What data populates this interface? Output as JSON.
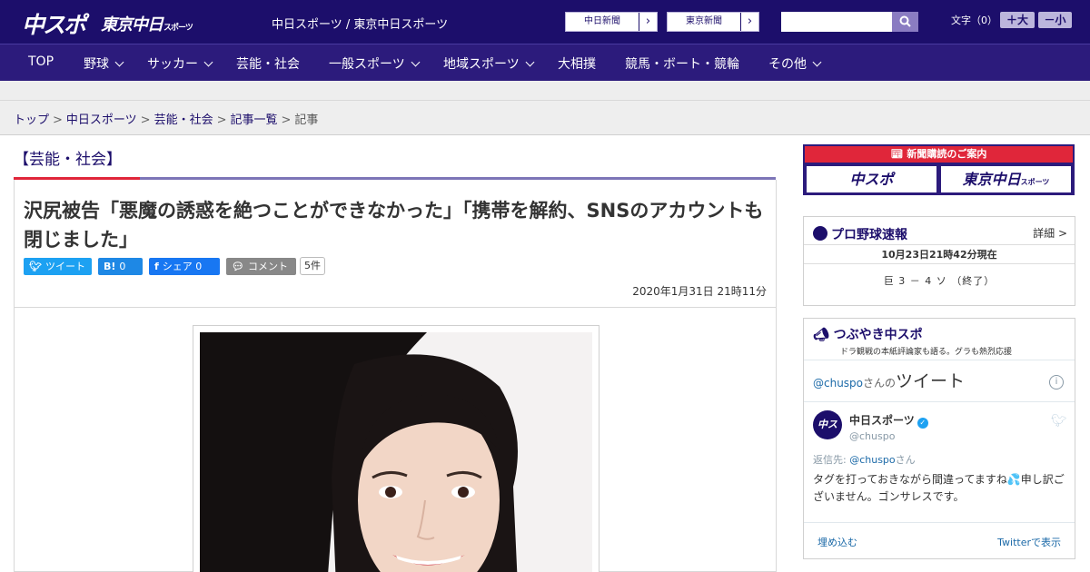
{
  "header": {
    "logo_chuspo": "中スポ",
    "logo_tokyo": "東京中日",
    "logo_tokyo_suffix": "スポーツ",
    "site_name": "中日スポーツ / 東京中日スポーツ",
    "ext_links": [
      {
        "label": "中日新聞"
      },
      {
        "label": "東京新聞"
      }
    ],
    "search_placeholder": "",
    "font_label": "文字（0）",
    "font_up": "＋大",
    "font_down": "－小"
  },
  "nav": {
    "items": [
      {
        "label": "TOP",
        "dropdown": false
      },
      {
        "label": "野球",
        "dropdown": true
      },
      {
        "label": "サッカー",
        "dropdown": true
      },
      {
        "label": "芸能・社会",
        "dropdown": false
      },
      {
        "label": "一般スポーツ",
        "dropdown": true
      },
      {
        "label": "地域スポーツ",
        "dropdown": true
      },
      {
        "label": "大相撲",
        "dropdown": false
      },
      {
        "label": "競馬・ボート・競輪",
        "dropdown": false
      },
      {
        "label": "その他",
        "dropdown": true
      }
    ]
  },
  "breadcrumb": {
    "items": [
      "トップ",
      "中日スポーツ",
      "芸能・社会",
      "記事一覧"
    ],
    "current": "記事",
    "separator": ">"
  },
  "article": {
    "category": "【芸能・社会】",
    "headline": "沢尻被告「悪魔の誘惑を絶つことができなかった」「携帯を解約、SNSのアカウントも閉じました」",
    "share": {
      "tweet": "ツイート",
      "hatena_icon": "B!",
      "hatena_count": "0",
      "facebook": "シェア 0",
      "comment": "コメント",
      "comment_count": "5件"
    },
    "date": "2020年1月31日 21時11分"
  },
  "sidebar": {
    "ad": {
      "title": "新聞購読のご案内",
      "logo1": "中スポ",
      "logo2": "東京中日",
      "logo2_suffix": "スポーツ"
    },
    "baseball": {
      "title": "プロ野球速報",
      "detail": "詳細 >",
      "updated": "10月23日21時42分現在",
      "score": "巨 3 － 4 ソ （終了）"
    },
    "twitter": {
      "title": "つぶやき中スポ",
      "subtitle": "ドラ観戦の本紙評論家も語る。グラも熱烈応援",
      "handle_prefix": "@chuspo",
      "handle_suffix": "さんの",
      "tweets_label": "ツイート",
      "user_name": "中日スポーツ",
      "user_handle": "@chuspo",
      "avatar_text": "中スポ",
      "reply_prefix": "返信先: ",
      "reply_to": "@chuspo",
      "reply_suffix": "さん",
      "body": "タグを打っておきながら間違ってますね💦申し訳ございません。ゴンサレスです。",
      "embed": "埋め込む",
      "view_on": "Twitterで表示"
    }
  },
  "colors": {
    "brand_navy": "#1c0e6b",
    "nav_purple": "#2c1b7c",
    "accent_red": "#e0263a",
    "twitter_blue": "#1da1f2"
  }
}
